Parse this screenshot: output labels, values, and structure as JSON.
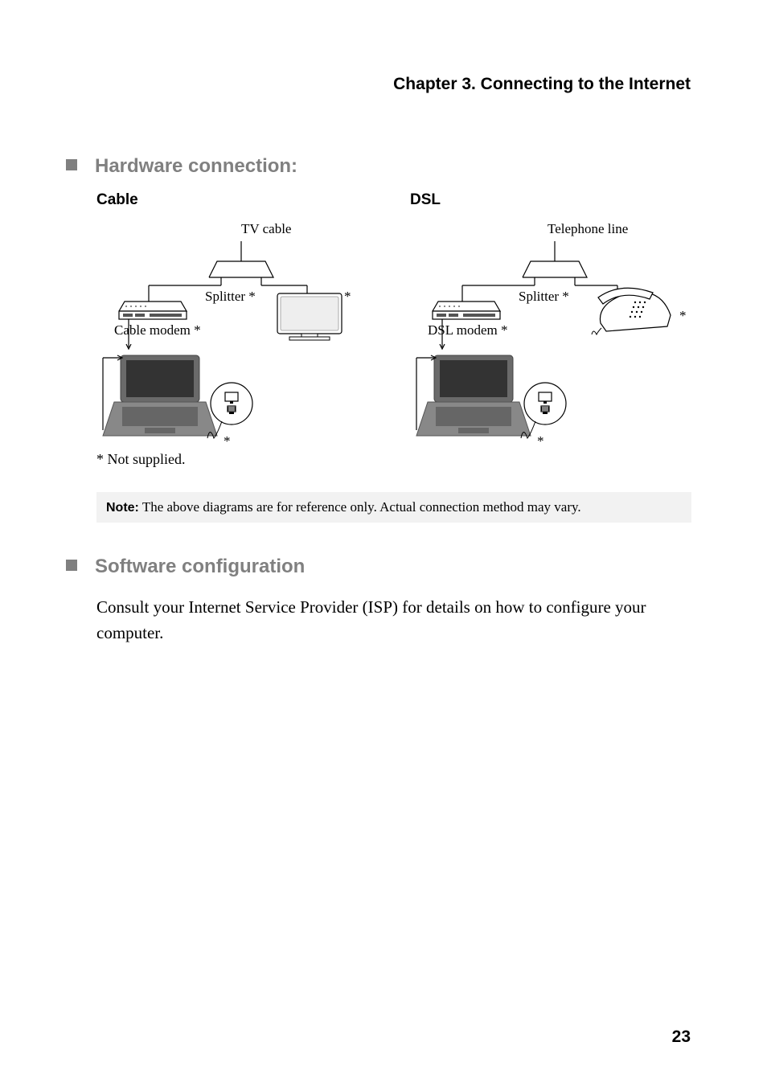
{
  "chapter_title": "Chapter 3. Connecting to the Internet",
  "hardware_heading": "Hardware connection:",
  "cable": {
    "title": "Cable",
    "source_label": "TV cable",
    "splitter_label": "Splitter *",
    "modem_label": "Cable modem *",
    "asterisk_tv": "*",
    "asterisk_cord": "*"
  },
  "dsl": {
    "title": "DSL",
    "source_label": "Telephone line",
    "splitter_label": "Splitter *",
    "modem_label": "DSL modem *",
    "asterisk_phone": "*",
    "asterisk_cord": "*"
  },
  "footnote": "* Not supplied.",
  "note_label": "Note:",
  "note_text": " The above diagrams are for reference only. Actual connection method may vary.",
  "software_heading": "Software configuration",
  "software_body": "Consult your Internet Service Provider (ISP) for details on how to configure your computer.",
  "page_number": "23"
}
